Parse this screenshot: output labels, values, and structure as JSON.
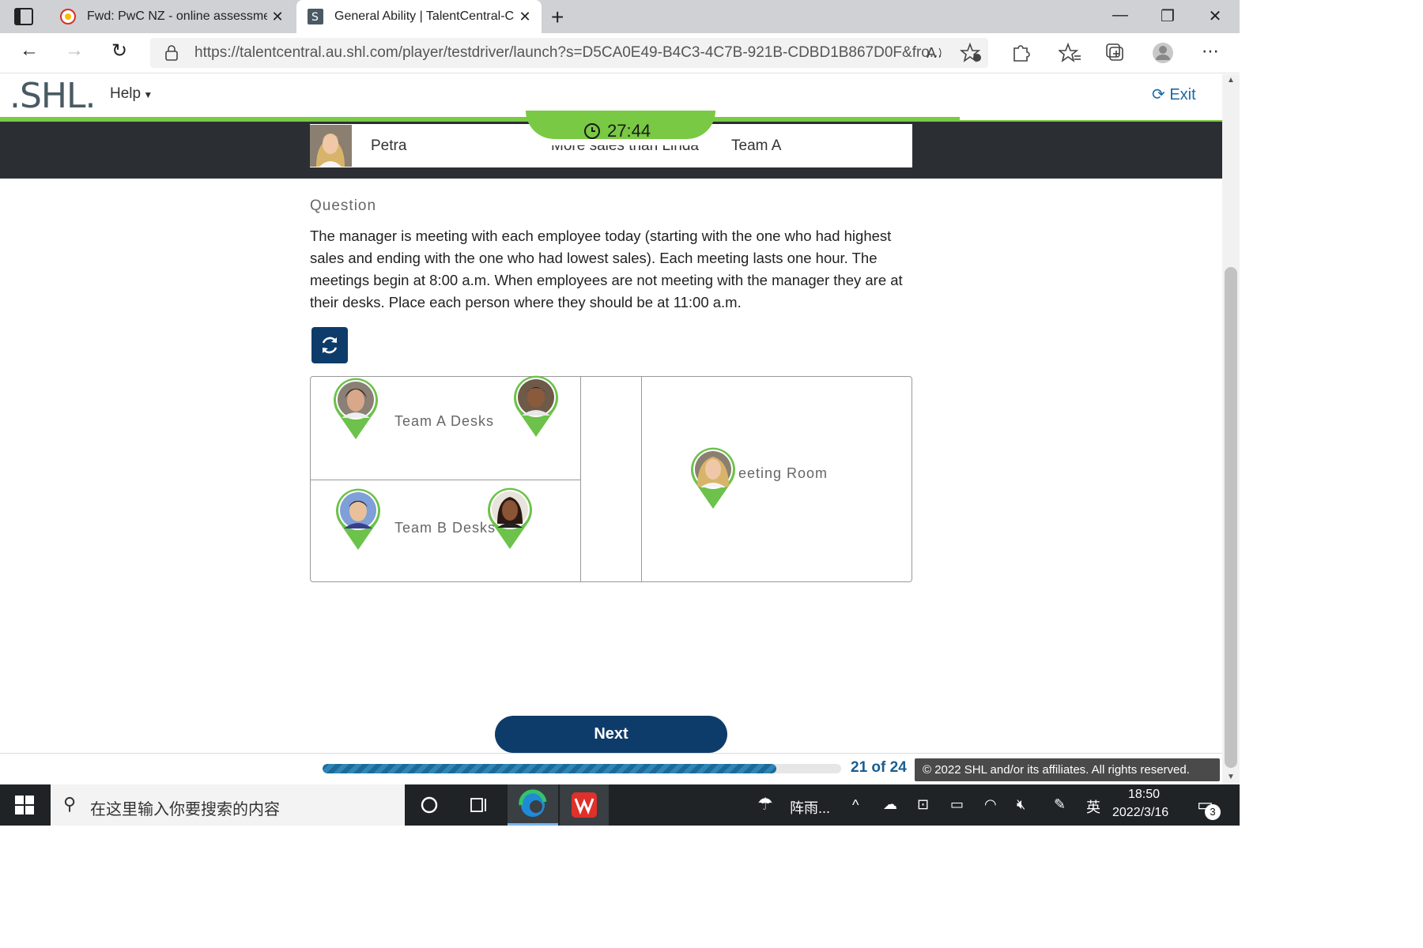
{
  "browser": {
    "tabs": [
      {
        "label": "Fwd: PwC NZ - online assessmen",
        "icon": "gmail-icon",
        "active": false
      },
      {
        "label": "General Ability | TalentCentral-Ca",
        "icon": "shl-favicon-icon",
        "active": true
      }
    ],
    "url": "https://talentcentral.au.shl.com/player/testdriver/launch?s=D5CA0E49-B4C3-4C7B-921B-CDBD1B867D0F&fro..."
  },
  "header": {
    "logo": ".SHL.",
    "help_label": "Help",
    "exit_label": "Exit"
  },
  "timer": {
    "value": "27:44"
  },
  "info_row": {
    "name": "Petra",
    "criteria": "More sales than Linda",
    "team": "Team A"
  },
  "question": {
    "heading": "Question",
    "text": "The manager is meeting with each employee today (starting with the one who had highest sales and ending with the one who had lowest sales). Each meeting lasts one hour. The meetings begin at 8:00 a.m. When employees are not meeting with the manager they are at their desks. Place each person where they should be at 11:00 a.m."
  },
  "zones": {
    "team_a": "Team A Desks",
    "team_b": "Team B Desks",
    "meeting": "Meeting Room"
  },
  "next_label": "Next",
  "progress": {
    "text": "21 of 24",
    "fraction": 0.875
  },
  "copyright": "© 2022 SHL and/or its affiliates. All rights reserved.",
  "taskbar": {
    "search_placeholder": "在这里输入你要搜索的内容",
    "weather": "阵雨...",
    "ime": "英",
    "time": "18:50",
    "date": "2022/3/16",
    "notifications": "3"
  },
  "colors": {
    "brand_green": "#79c944",
    "brand_navy": "#0e3c6a",
    "link_blue": "#1b6aa5"
  }
}
